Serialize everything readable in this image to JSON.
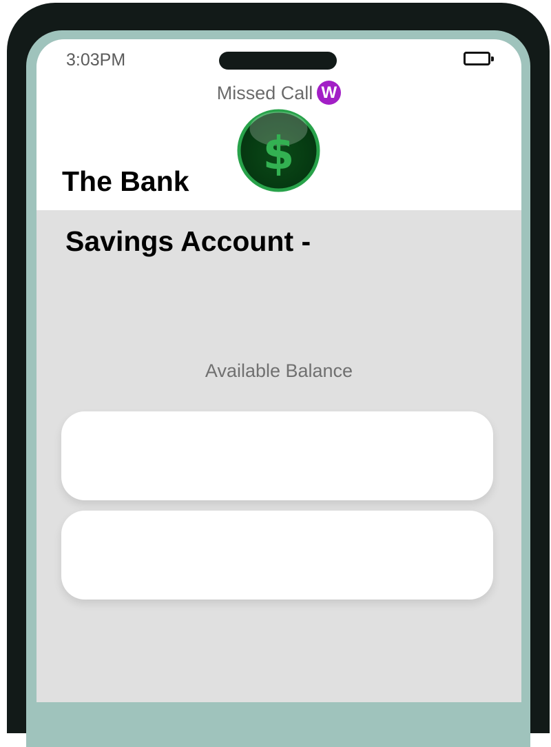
{
  "status_bar": {
    "time": "3:03PM",
    "battery_icon": "battery-icon"
  },
  "notification": {
    "label": "Missed Call",
    "badge_letter": "W",
    "badge_color": "#a21fc6"
  },
  "bank": {
    "name": "The Bank",
    "logo_icon": "dollar-coin-icon",
    "logo_symbol": "$",
    "logo_color": "#0e5a1e"
  },
  "account": {
    "title": "Savings Account -",
    "balance_label": "Available Balance"
  },
  "colors": {
    "phone_frame": "#121a18",
    "phone_rim": "#9fc3bc",
    "screen_background": "#e0e0e0"
  }
}
